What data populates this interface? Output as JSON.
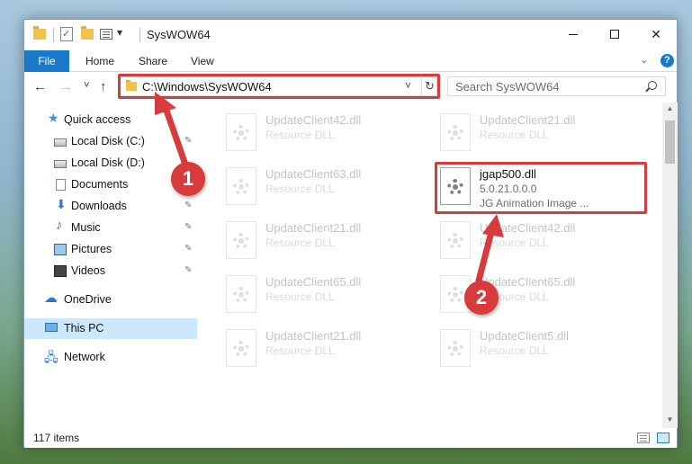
{
  "window": {
    "title": "SysWOW64",
    "controls": {
      "minimize": "–",
      "maximize": "□",
      "close": "✕"
    }
  },
  "ribbon": {
    "tabs": [
      "File",
      "Home",
      "Share",
      "View"
    ],
    "help": "?"
  },
  "nav": {
    "back": "←",
    "forward": "→",
    "recent": "˅",
    "up": "↑",
    "address": "C:\\Windows\\SysWOW64",
    "address_dropdown": "˅",
    "refresh": "↻",
    "search_placeholder": "Search SysWOW64"
  },
  "sidebar": {
    "items": [
      {
        "label": "Quick access",
        "icon": "star-icon",
        "pinned": false
      },
      {
        "label": "Local Disk (C:)",
        "icon": "disk-icon",
        "pinned": true
      },
      {
        "label": "Local Disk (D:)",
        "icon": "disk-icon",
        "pinned": false
      },
      {
        "label": "Documents",
        "icon": "documents-icon",
        "pinned": true
      },
      {
        "label": "Downloads",
        "icon": "downloads-icon",
        "pinned": true
      },
      {
        "label": "Music",
        "icon": "music-icon",
        "pinned": true
      },
      {
        "label": "Pictures",
        "icon": "pictures-icon",
        "pinned": true
      },
      {
        "label": "Videos",
        "icon": "videos-icon",
        "pinned": true
      },
      {
        "label": "OneDrive",
        "icon": "onedrive-icon",
        "pinned": false
      },
      {
        "label": "This PC",
        "icon": "pc-icon",
        "pinned": false,
        "selected": true
      },
      {
        "label": "Network",
        "icon": "network-icon",
        "pinned": false
      }
    ],
    "pin_glyph": "📌"
  },
  "files": [
    {
      "name": "UpdateClient42.dll",
      "type": "Resource DLL"
    },
    {
      "name": "UpdateClient21.dll",
      "type": "Resource DLL"
    },
    {
      "name": "UpdateClient63.dll",
      "type": "Resource DLL"
    },
    {
      "name": "jgap500.dll",
      "version": "5.0.21.0.0.0",
      "type": "JG Animation Image ...",
      "highlighted": true
    },
    {
      "name": "UpdateClient21.dll",
      "type": "Resource DLL"
    },
    {
      "name": "UpdateClient42.dll",
      "type": "Resource DLL"
    },
    {
      "name": "UpdateClient65.dll",
      "type": "Resource DLL"
    },
    {
      "name": "UpdateClient65.dll",
      "type": "Resource DLL"
    },
    {
      "name": "UpdateClient21.dll",
      "type": "Resource DLL"
    },
    {
      "name": "UpdateClient5.dll",
      "type": "Resource DLL"
    }
  ],
  "status": {
    "item_count": "117 items"
  },
  "annotations": {
    "badge1": "1",
    "badge2": "2",
    "color": "#d83b3b"
  },
  "colors": {
    "accent": "#1979ca",
    "selection": "#cce8ff",
    "annotation": "#d83b3b"
  }
}
